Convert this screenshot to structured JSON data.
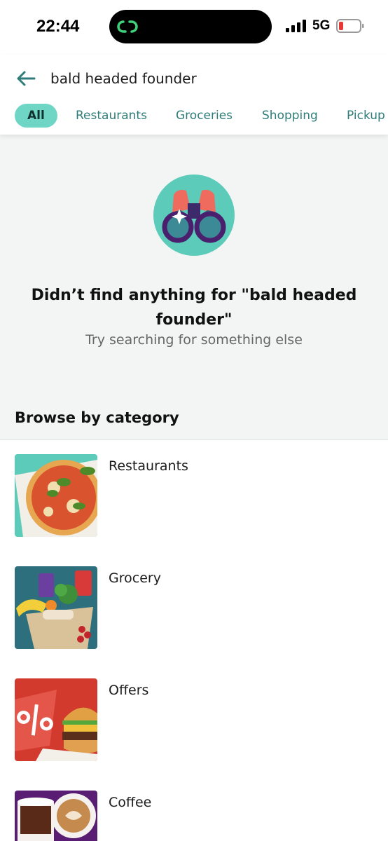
{
  "status_bar": {
    "time": "22:44",
    "network": "5G",
    "icons": [
      "app-link-icon",
      "signal-icon",
      "battery-low-icon"
    ]
  },
  "search": {
    "query": "bald headed founder",
    "back_icon": "arrow-left-icon"
  },
  "tabs": [
    {
      "label": "All",
      "active": true
    },
    {
      "label": "Restaurants",
      "active": false
    },
    {
      "label": "Groceries",
      "active": false
    },
    {
      "label": "Shopping",
      "active": false
    },
    {
      "label": "Pickup",
      "active": false
    }
  ],
  "empty_state": {
    "icon": "binoculars-icon",
    "title": "Didn’t find anything for \"bald headed founder\"",
    "subtitle": "Try searching for something else"
  },
  "browse": {
    "title": "Browse by category",
    "categories": [
      {
        "label": "Restaurants",
        "image": "pizza-image"
      },
      {
        "label": "Grocery",
        "image": "grocery-bag-image"
      },
      {
        "label": "Offers",
        "image": "burger-offer-image"
      },
      {
        "label": "Coffee",
        "image": "coffee-cups-image"
      }
    ]
  },
  "colors": {
    "accent": "#6fd6c6",
    "accent_text": "#2f7d78",
    "empty_bg": "#f3f5f5"
  }
}
